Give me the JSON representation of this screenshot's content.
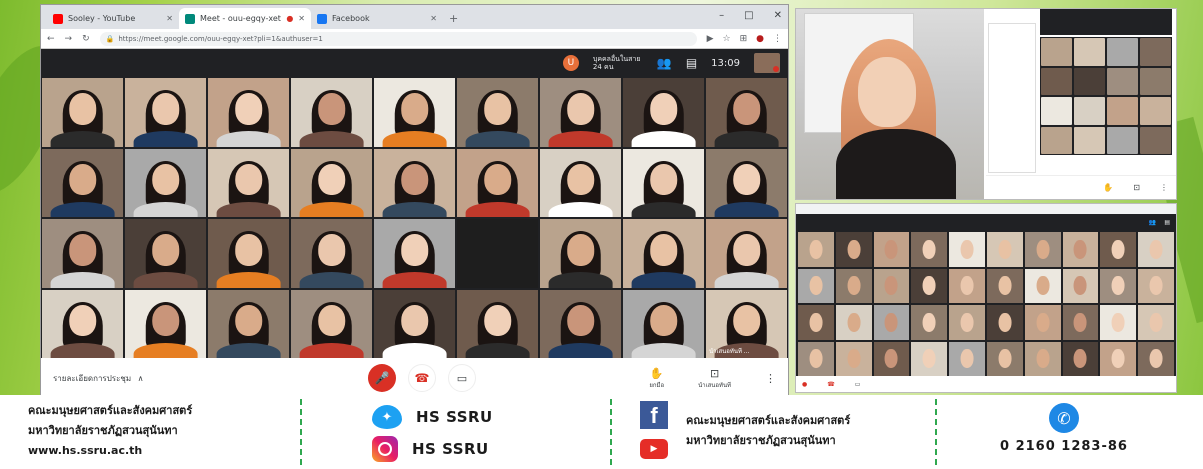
{
  "browser": {
    "tabs": [
      {
        "label": "Sooley - YouTube",
        "color": "#ff0000"
      },
      {
        "label": "Meet - ouu-egqy-xet",
        "color": "#00897b"
      },
      {
        "label": "Facebook",
        "color": "#1877f2"
      }
    ],
    "url": "https://meet.google.com/ouu-egqy-xet?pli=1&authuser=1"
  },
  "meet": {
    "participants_label": "บุคคลอื่นในสาย 24 คน",
    "avatar_letter": "U",
    "time": "13:09",
    "meeting_details": "รายละเอียดการประชุม",
    "present_label": "ยกมือ",
    "present_now_label": "นำเสนอทันที",
    "pinned_name": "นำเสนอทันที ..."
  },
  "footer": {
    "faculty_line1": "คณะมนุษยศาสตร์และสังคมศาสตร์",
    "faculty_line2": "มหาวิทยาลัยราชภัฏสวนสุนันทา",
    "website": "www.hs.ssru.ac.th",
    "twitter": "HS SSRU",
    "instagram": "HS SSRU",
    "fb_line1": "คณะมนุษยศาสตร์และสังคมศาสตร์",
    "fb_line2": "มหาวิทยาลัยราชภัฏสวนสุนันทา",
    "phone": "0 2160 1283-86"
  },
  "colors": {
    "accent_green": "#2fa84f",
    "meet_dark": "#202124",
    "mic_red": "#d93025"
  }
}
